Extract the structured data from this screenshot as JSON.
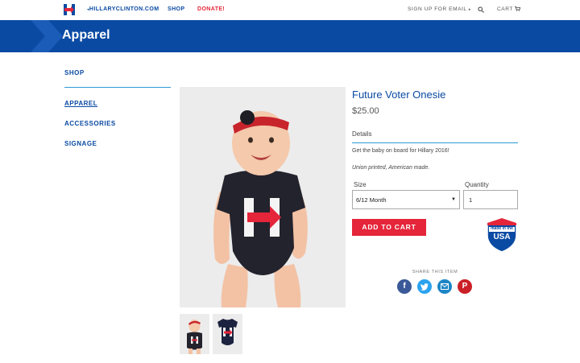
{
  "nav": {
    "site_link": "HILLARYCLINTON.COM",
    "shop": "SHOP",
    "donate": "DONATE!",
    "signup": "SIGN UP FOR EMAIL",
    "cart": "CART"
  },
  "banner": {
    "title": "Apparel"
  },
  "sidebar": {
    "heading": "SHOP",
    "items": [
      {
        "label": "APPAREL",
        "active": true
      },
      {
        "label": "ACCESSORIES",
        "active": false
      },
      {
        "label": "SIGNAGE",
        "active": false
      }
    ]
  },
  "product": {
    "title": "Future Voter Onesie",
    "price": "$25.00",
    "details_label": "Details",
    "description": "Get the baby on board for Hillary 2016!",
    "made_note": "Union printed, American made.",
    "size_label": "Size",
    "size_value": "6/12 Month",
    "quantity_label": "Quantity",
    "quantity_value": "1",
    "add_to_cart": "ADD TO CART",
    "badge": {
      "line1": "made in the",
      "line2": "USA"
    }
  },
  "share": {
    "label": "SHARE THIS ITEM",
    "icons": [
      "facebook-icon",
      "twitter-icon",
      "email-icon",
      "pinterest-icon"
    ]
  },
  "colors": {
    "brand_blue": "#0a4aa3",
    "accent_red": "#e5253a",
    "rule_blue": "#2c9bd6"
  }
}
